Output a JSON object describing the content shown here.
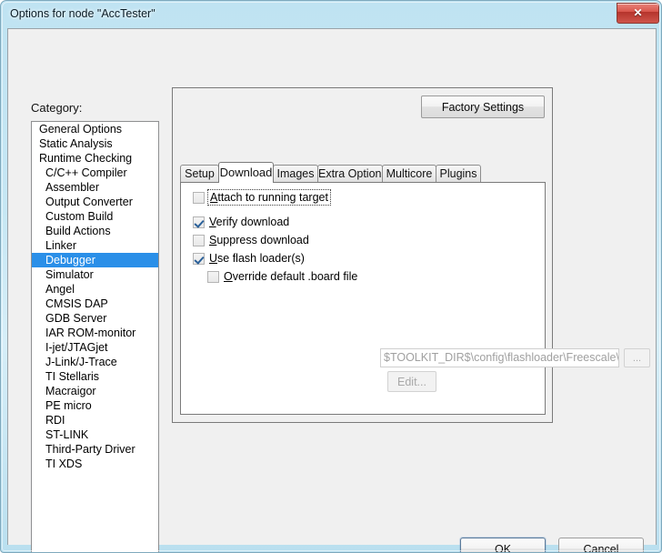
{
  "window": {
    "title": "Options for node \"AccTester\"",
    "close_label": "✕",
    "accent_selection": "#2a8fe8",
    "titlebar_color": "#c6e7f4",
    "close_color": "#c94338"
  },
  "category": {
    "label": "Category:",
    "selected": "Debugger",
    "items": [
      {
        "label": "General Options",
        "indent": false
      },
      {
        "label": "Static Analysis",
        "indent": false
      },
      {
        "label": "Runtime Checking",
        "indent": false
      },
      {
        "label": "C/C++ Compiler",
        "indent": true
      },
      {
        "label": "Assembler",
        "indent": true
      },
      {
        "label": "Output Converter",
        "indent": true
      },
      {
        "label": "Custom Build",
        "indent": true
      },
      {
        "label": "Build Actions",
        "indent": true
      },
      {
        "label": "Linker",
        "indent": true
      },
      {
        "label": "Debugger",
        "indent": true
      },
      {
        "label": "Simulator",
        "indent": true
      },
      {
        "label": "Angel",
        "indent": true
      },
      {
        "label": "CMSIS DAP",
        "indent": true
      },
      {
        "label": "GDB Server",
        "indent": true
      },
      {
        "label": "IAR ROM-monitor",
        "indent": true
      },
      {
        "label": "I-jet/JTAGjet",
        "indent": true
      },
      {
        "label": "J-Link/J-Trace",
        "indent": true
      },
      {
        "label": "TI Stellaris",
        "indent": true
      },
      {
        "label": "Macraigor",
        "indent": true
      },
      {
        "label": "PE micro",
        "indent": true
      },
      {
        "label": "RDI",
        "indent": true
      },
      {
        "label": "ST-LINK",
        "indent": true
      },
      {
        "label": "Third-Party Driver",
        "indent": true
      },
      {
        "label": "TI XDS",
        "indent": true
      }
    ]
  },
  "panel": {
    "factory_settings_label": "Factory Settings",
    "tabs": [
      {
        "label": "Setup",
        "active": false
      },
      {
        "label": "Download",
        "active": true
      },
      {
        "label": "Images",
        "active": false
      },
      {
        "label": "Extra Options",
        "active": false
      },
      {
        "label": "Multicore",
        "active": false
      },
      {
        "label": "Plugins",
        "active": false
      }
    ]
  },
  "download_tab": {
    "checkboxes": [
      {
        "id": "attach-to-running-target",
        "label": "Attach to running target",
        "accel": "A",
        "checked": false,
        "focused": true,
        "indent": false
      },
      {
        "id": "verify-download",
        "label": "Verify download",
        "accel": "V",
        "checked": true,
        "focused": false,
        "indent": false
      },
      {
        "id": "suppress-download",
        "label": "Suppress download",
        "accel": "S",
        "checked": false,
        "focused": false,
        "indent": false
      },
      {
        "id": "use-flash-loaders",
        "label": "Use flash loader(s)",
        "accel": "U",
        "checked": true,
        "focused": false,
        "indent": false
      },
      {
        "id": "override-default-board-file",
        "label": "Override default  .board file",
        "accel": "O",
        "checked": false,
        "focused": false,
        "indent": true
      }
    ],
    "path_value": "$TOOLKIT_DIR$\\config\\flashloader\\Freescale\\Flash",
    "path_placeholder": "",
    "browse_label": "...",
    "edit_label": "Edit..."
  },
  "footer": {
    "ok_label": "OK",
    "cancel_label": "Cancel"
  }
}
